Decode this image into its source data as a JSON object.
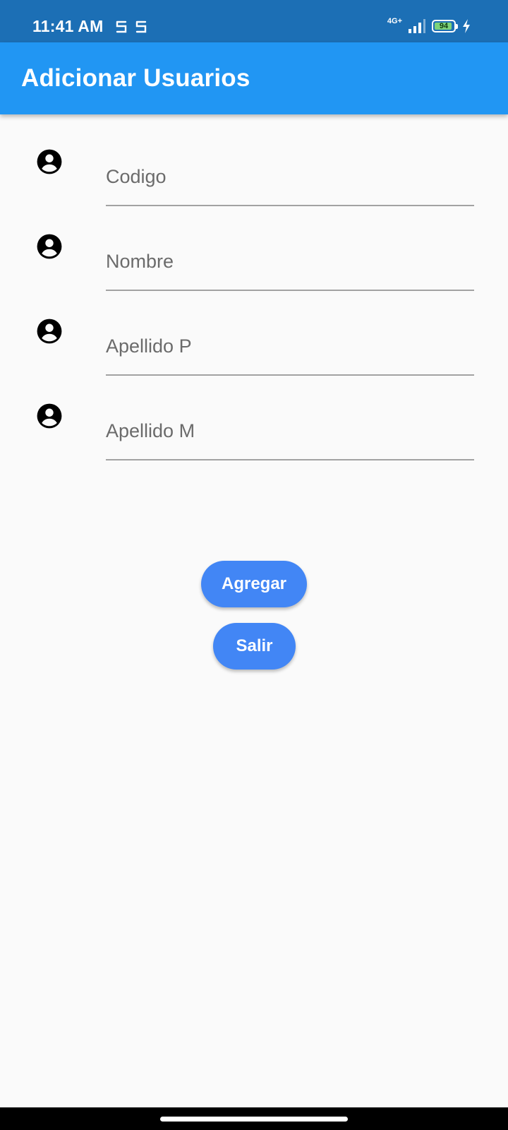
{
  "status_bar": {
    "time": "11:41 AM",
    "network_type": "4G+",
    "battery_level": "94",
    "battery_fraction": 0.94,
    "icons": [
      "notification-icon",
      "notification-icon",
      "signal-icon",
      "battery-icon",
      "charging-icon"
    ]
  },
  "app_bar": {
    "title": "Adicionar Usuarios",
    "color": "#2196f3"
  },
  "form": {
    "fields": [
      {
        "placeholder": "Codigo",
        "value": "",
        "icon": "account-circle-icon"
      },
      {
        "placeholder": "Nombre",
        "value": "",
        "icon": "account-circle-icon"
      },
      {
        "placeholder": "Apellido P",
        "value": "",
        "icon": "account-circle-icon"
      },
      {
        "placeholder": "Apellido M",
        "value": "",
        "icon": "account-circle-icon"
      }
    ]
  },
  "buttons": {
    "add_label": "Agregar",
    "exit_label": "Salir",
    "color": "#4286f5"
  },
  "colors": {
    "status_bar": "#1c6fb5",
    "background": "#fafafa"
  }
}
